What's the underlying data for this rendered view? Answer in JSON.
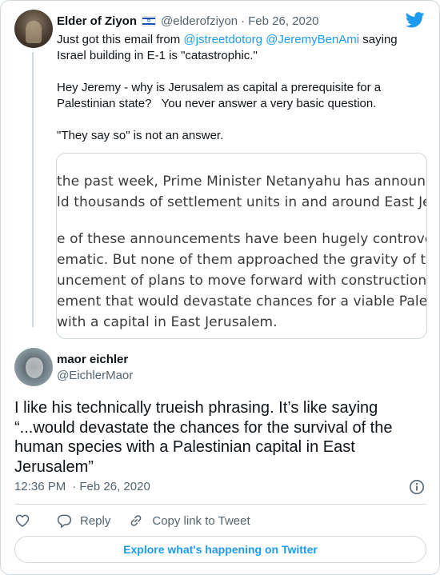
{
  "colors": {
    "accent": "#1d9bf0",
    "text": "#0f1419",
    "muted": "#536471",
    "border": "#cfd9de"
  },
  "tweet1": {
    "name": "Elder of Ziyon",
    "flag_icon": "israel-flag-icon",
    "handle": "@elderofziyon",
    "date": "Feb 26, 2020",
    "text": {
      "intro": "Just got this email from ",
      "mention1": "@jstreetdotorg",
      "mention2": "@JeremyBenAmi",
      "intro_end": " saying",
      "line2": "Israel building in E-1 is \"catastrophic.\"",
      "para2_line1": "Hey Jeremy - why is Jerusalem as capital a prerequisite for a",
      "para2_line2": "Palestinian state?   You never answer a very basic question.",
      "para3": "\"They say so\" is not an answer."
    },
    "media_lines": [
      "the past week, Prime Minister Netanyahu has announce",
      "ld thousands of settlement units in and around East Je",
      "e of these announcements have been hugely controvers",
      "ematic. But none of them approached the gravity of tod",
      "uncement of plans to move forward with construction o",
      "ement that would devastate chances for a viable Palesti",
      "with a capital in East Jerusalem."
    ]
  },
  "tweet2": {
    "name": "maor eichler",
    "handle": "@EichlerMaor",
    "text": "I like his technically trueish phrasing. It’s like saying “...would devastate the chances for the survival of the human species with a Palestinian capital in East Jerusalem”",
    "time": "12:36 PM",
    "date": "Feb 26, 2020"
  },
  "actions": {
    "reply_label": "Reply",
    "copy_label": "Copy link to Tweet"
  },
  "explore_label": "Explore what's happening on Twitter"
}
